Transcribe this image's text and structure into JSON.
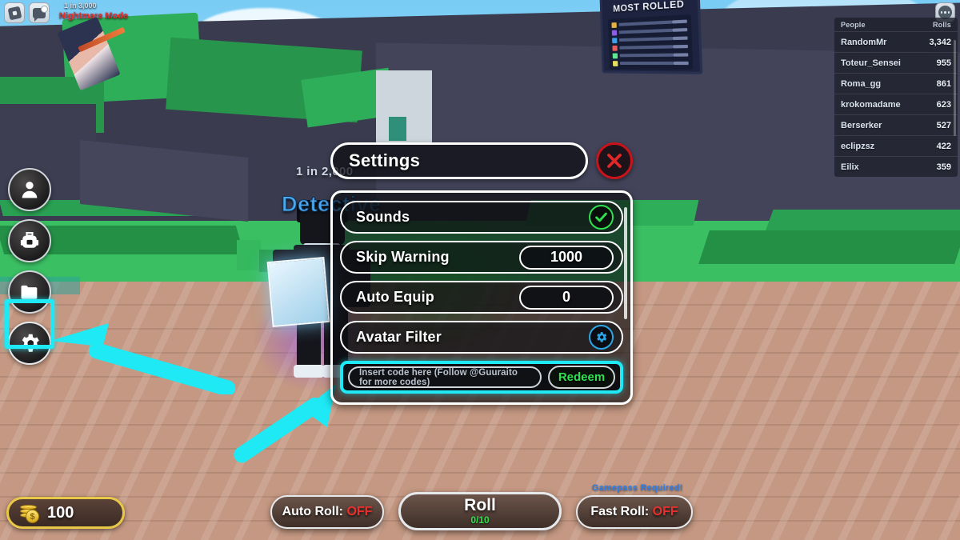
{
  "topbar": {
    "roblox_icon": "roblox-logo-icon",
    "chat_icon": "chat-icon",
    "menu_icon": "three-dots-menu-icon"
  },
  "world": {
    "billboard_title": "MOST ROLLED",
    "aura_rate": "1 in 2,000",
    "aura_name": "Detective",
    "float_item_rate": "1 in 3,000",
    "float_item_name": "Nightmare Mode"
  },
  "leaderboard": {
    "col_people": "People",
    "col_rolls": "Rolls",
    "rows": [
      {
        "name": "RandomMr",
        "rolls": "3,342"
      },
      {
        "name": "Toteur_Sensei",
        "rolls": "955"
      },
      {
        "name": "Roma_gg",
        "rolls": "861"
      },
      {
        "name": "krokomadame",
        "rolls": "623"
      },
      {
        "name": "Berserker",
        "rolls": "527"
      },
      {
        "name": "eclipzsz",
        "rolls": "422"
      },
      {
        "name": "Eilix",
        "rolls": "359"
      }
    ]
  },
  "sidebar": {
    "items": [
      {
        "icon": "person-icon",
        "name": "avatar-button"
      },
      {
        "icon": "backpack-icon",
        "name": "inventory-button"
      },
      {
        "icon": "folder-icon",
        "name": "index-button"
      },
      {
        "icon": "gear-icon",
        "name": "settings-button"
      }
    ]
  },
  "settings": {
    "title": "Settings",
    "close_icon": "close-x-icon",
    "rows": [
      {
        "label": "Sounds",
        "control": "toggle",
        "value": "on",
        "icon": "check-icon"
      },
      {
        "label": "Skip Warning",
        "control": "value",
        "value": "1000"
      },
      {
        "label": "Auto Equip",
        "control": "value",
        "value": "0"
      },
      {
        "label": "Avatar Filter",
        "control": "gear",
        "icon": "gear-icon"
      }
    ],
    "code_placeholder": "Insert code here (Follow @Guuraito for more codes)",
    "redeem_label": "Redeem"
  },
  "bottom": {
    "coins": "100",
    "coin_icon": "coin-stack-icon",
    "auto_roll_label": "Auto Roll: ",
    "auto_roll_state": "OFF",
    "roll_label": "Roll",
    "roll_count": "0/10",
    "fast_roll_label": "Fast Roll: ",
    "fast_roll_state": "OFF",
    "gamepass_note": "Gamepass Required!"
  },
  "annotations": {
    "arrow_to_settings": "cyan-arrow-icon",
    "arrow_to_code_box": "cyan-arrow-icon",
    "highlight_color": "#1ee9f5"
  }
}
